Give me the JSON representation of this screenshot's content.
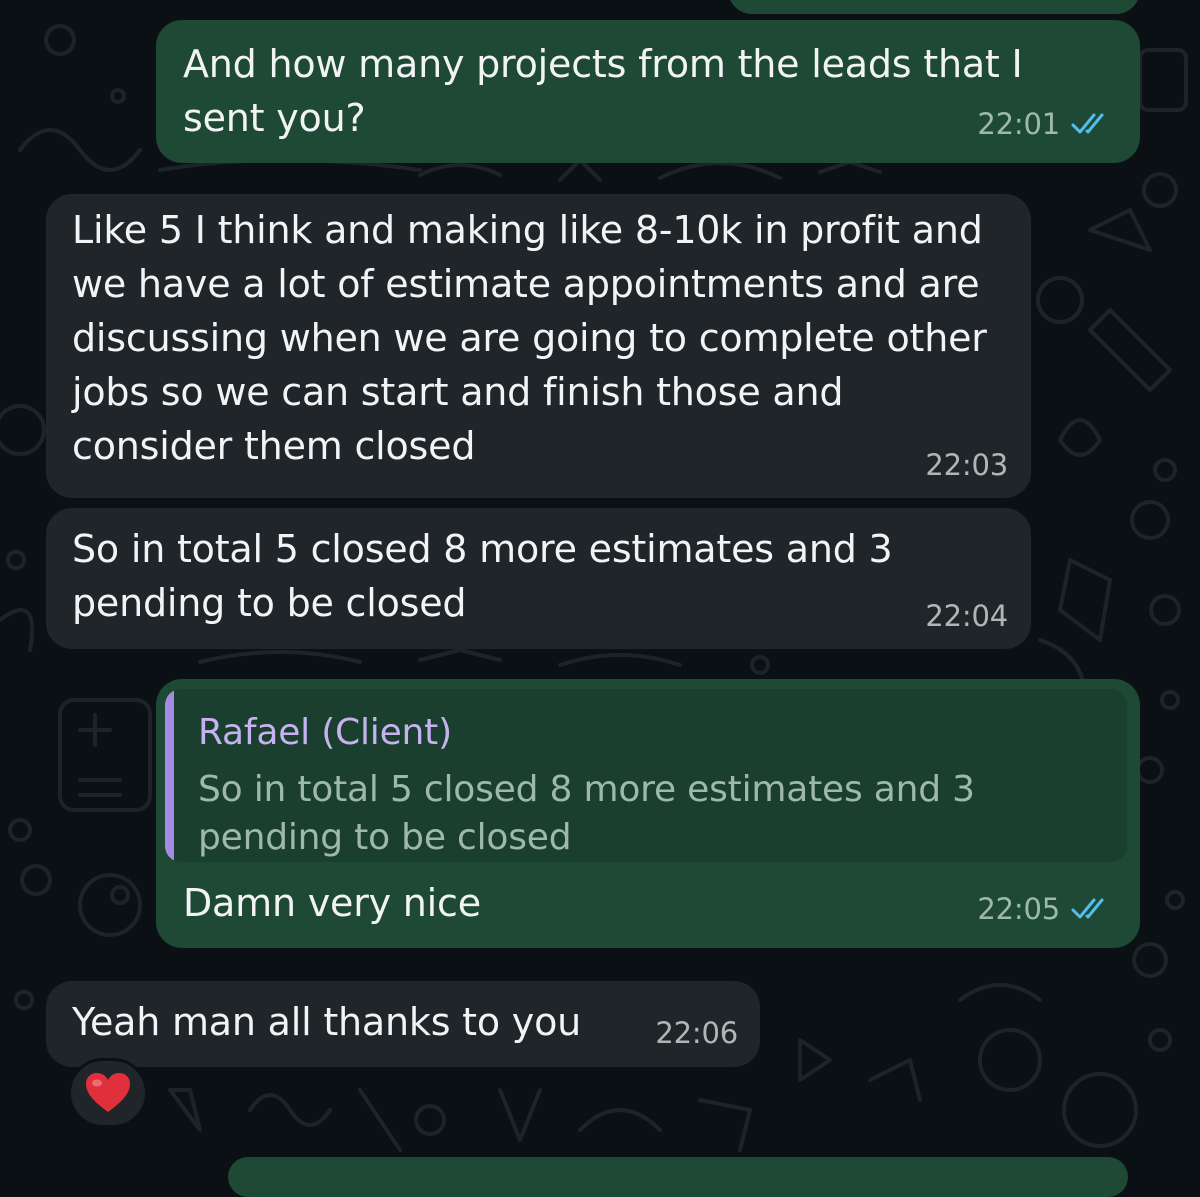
{
  "messages": [
    {
      "direction": "outgoing",
      "text": "And how many projects from the leads that I sent you?",
      "time": "22:01",
      "status_icon": "double-check-read-icon"
    },
    {
      "direction": "incoming",
      "text": "Like 5 I think and making like 8-10k in profit and we have a lot of estimate appointments and are discussing when we are going to complete other jobs so we can start and finish those and consider them closed",
      "time": "22:03"
    },
    {
      "direction": "incoming",
      "text": "So in total 5 closed 8 more estimates and 3 pending to be closed",
      "time": "22:04"
    },
    {
      "direction": "outgoing",
      "quoted": {
        "author": "Rafael (Client)",
        "text": "So in total 5 closed 8 more estimates and 3 pending to be closed"
      },
      "text": "Damn very nice",
      "time": "22:05",
      "status_icon": "double-check-read-icon"
    },
    {
      "direction": "incoming",
      "text": "Yeah man all thanks to you",
      "time": "22:06",
      "reaction": "red-heart-icon"
    }
  ],
  "colors": {
    "background": "#0b1014",
    "outgoing_bubble": "#1e4a35",
    "incoming_bubble": "#1f2528",
    "quote_bar": "#a58be6",
    "read_ticks": "#53bdeb",
    "heart": "#e0303c"
  }
}
